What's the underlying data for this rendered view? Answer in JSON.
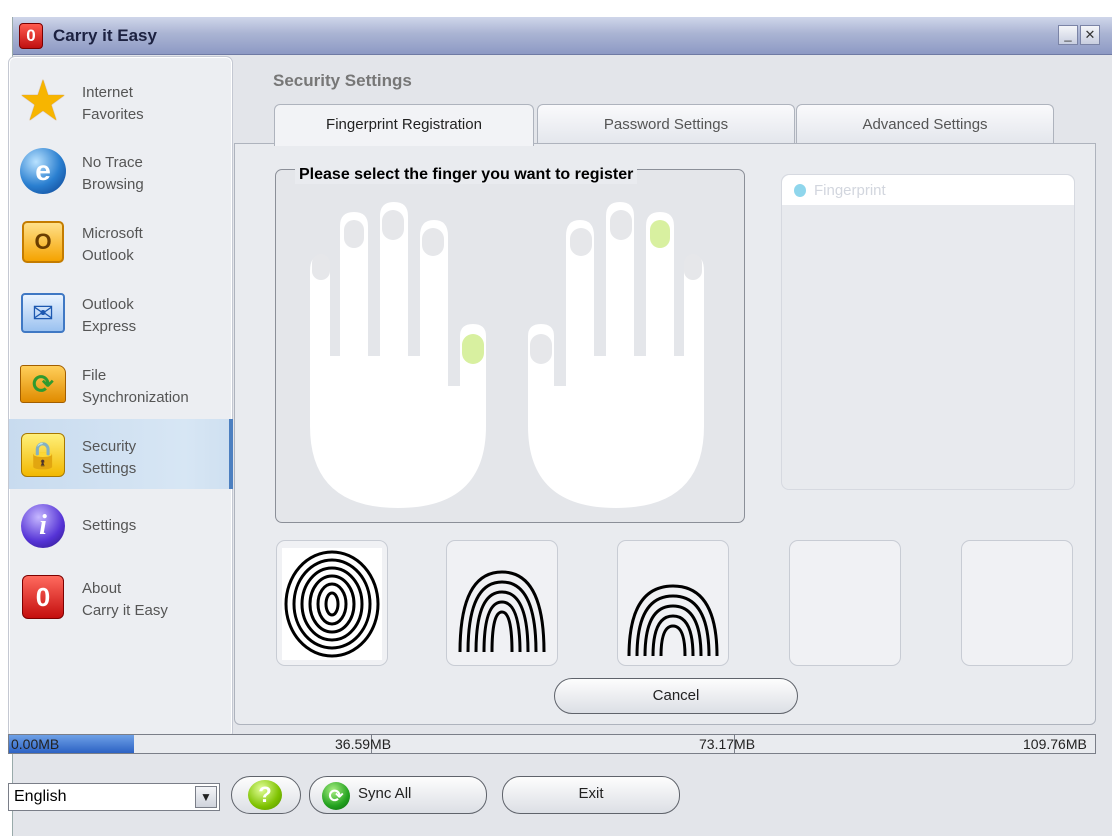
{
  "window": {
    "title": "Carry it Easy",
    "logo_glyph": "0",
    "minimize_glyph": "_",
    "close_glyph": "✕"
  },
  "sidebar": {
    "items": [
      {
        "label": "Internet\nFavorites",
        "icon": "star-icon",
        "glyph": "★"
      },
      {
        "label": "No Trace\nBrowsing",
        "icon": "browser-orb-icon",
        "glyph": "e"
      },
      {
        "label": "Microsoft\nOutlook",
        "icon": "outlook-icon",
        "glyph": "O"
      },
      {
        "label": "Outlook\nExpress",
        "icon": "outlook-express-icon",
        "glyph": "✉"
      },
      {
        "label": "File\nSynchronization",
        "icon": "folder-sync-icon",
        "glyph": "⟳"
      },
      {
        "label": "Security\nSettings",
        "icon": "lock-icon",
        "glyph": "🔒",
        "active": true
      },
      {
        "label": "Settings",
        "icon": "info-icon",
        "glyph": "i"
      },
      {
        "label": "About\nCarry it Easy",
        "icon": "app-logo-icon",
        "glyph": "0"
      }
    ]
  },
  "main": {
    "section_title": "Security Settings",
    "tabs": [
      {
        "label": "Fingerprint Registration",
        "active": true
      },
      {
        "label": "Password Settings",
        "active": false
      },
      {
        "label": "Advanced Settings",
        "active": false
      }
    ],
    "finger_prompt": "Please select the finger you want to register",
    "fingerprint_panel_title": "Fingerprint",
    "cancel_label": "Cancel",
    "registered_thumbnails": 3,
    "empty_thumbnails": 2,
    "highlight_color": "#d8f0a0"
  },
  "storage": {
    "labels": [
      "0.00MB",
      "36.59MB",
      "73.17MB",
      "109.76MB"
    ],
    "used_fraction": 0.115
  },
  "bottom": {
    "language": "English",
    "help_glyph": "?",
    "sync_glyph": "⟳",
    "sync_label": "Sync All",
    "exit_label": "Exit",
    "dropdown_glyph": "▼"
  }
}
